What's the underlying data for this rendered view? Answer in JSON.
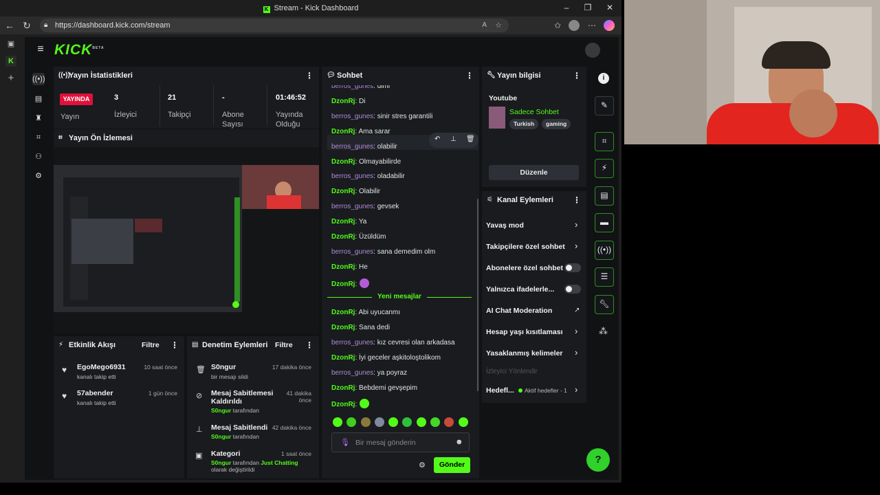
{
  "window": {
    "title": "Stream - Kick Dashboard",
    "url": "https://dashboard.kick.com/stream"
  },
  "brand": {
    "logo": "KICK",
    "beta": "BETA",
    "accent": "#53fc18"
  },
  "stats": {
    "title": "Yayın İstatistikleri",
    "live_badge": "YAYINDA",
    "stream_label": "Yayın",
    "viewers_value": "3",
    "viewers_label": "İzleyici",
    "followers_value": "21",
    "followers_label": "Takipçi",
    "subs_value": "-",
    "subs_label": "Abone Sayısı",
    "uptime_value": "01:46:52",
    "uptime_label": "Yayında Olduğu"
  },
  "preview": {
    "title": "Yayın Ön İzlemesi"
  },
  "chat": {
    "title": "Sohbet",
    "messages_before": [
      {
        "user": "berros_gunes",
        "text": ": dimi",
        "color": "purple"
      },
      {
        "user": "DzonRj",
        "text": ": Di",
        "color": "green"
      },
      {
        "user": "berros_gunes",
        "text": ": sinir stres garantili",
        "color": "purple"
      },
      {
        "user": "DzonRj",
        "text": ": Ama sarar",
        "color": "green"
      },
      {
        "user": "berros_gunes",
        "text": ": olabilir",
        "color": "purple"
      },
      {
        "user": "DzonRj",
        "text": ": Olmayabilirde",
        "color": "green"
      },
      {
        "user": "berros_gunes",
        "text": ": oladabilir",
        "color": "purple"
      },
      {
        "user": "DzonRj",
        "text": ": Olabilir",
        "color": "green"
      },
      {
        "user": "berros_gunes",
        "text": ": gevsek",
        "color": "purple"
      },
      {
        "user": "DzonRj",
        "text": ": Ya",
        "color": "green"
      },
      {
        "user": "DzonRj",
        "text": ": Üzüldüm",
        "color": "green"
      },
      {
        "user": "berros_gunes",
        "text": ": sana demedim olm",
        "color": "purple"
      },
      {
        "user": "DzonRj",
        "text": ": He",
        "color": "green"
      },
      {
        "user": "DzonRj",
        "text": ":",
        "color": "green"
      }
    ],
    "new_messages_divider": "Yeni mesajlar",
    "messages_after": [
      {
        "user": "DzonRj",
        "text": ": Abi uyucanmı",
        "color": "green"
      },
      {
        "user": "DzonRj",
        "text": ": Sana dedi",
        "color": "green"
      },
      {
        "user": "berros_gunes",
        "text": ": kız cevresi olan arkadasa",
        "color": "purple"
      },
      {
        "user": "DzonRj",
        "text": ": İyi geceler aşkitoloştolikom",
        "color": "green"
      },
      {
        "user": "berros_gunes",
        "text": ": ya poyraz",
        "color": "purple"
      },
      {
        "user": "DzonRj",
        "text": ": Bebdemi gevşepim",
        "color": "green"
      },
      {
        "user": "DzonRj",
        "text": ":",
        "color": "green"
      }
    ],
    "input_placeholder": "Bir mesaj gönderin",
    "send_label": "Gönder"
  },
  "stream_info": {
    "title": "Yayın bilgisi",
    "stream_title": "Youtube",
    "category": "Sadece Sohbet",
    "tags": [
      "Turkish",
      "gaming"
    ],
    "edit_label": "Düzenle"
  },
  "channel_actions": {
    "title": "Kanal Eylemleri",
    "items": [
      {
        "label": "Yavaş mod",
        "control": "chevron"
      },
      {
        "label": "Takipçilere özel sohbet",
        "control": "chevron"
      },
      {
        "label": "Abonelere özel sohbet",
        "control": "toggle"
      },
      {
        "label": "Yalnızca ifadelerle...",
        "control": "toggle"
      },
      {
        "label": "AI Chat Moderation",
        "control": "external"
      },
      {
        "label": "Hesap yaşı kısıtlaması",
        "control": "chevron"
      },
      {
        "label": "Yasaklanmış kelimeler",
        "control": "chevron"
      }
    ],
    "viewer_redirect": "İzleyici Yönlendir",
    "goals_label": "Hedefl...",
    "goals_status": "Aktif hedefler - 1"
  },
  "activity": {
    "title": "Etkinlik Akışı",
    "filter": "Filtre",
    "items": [
      {
        "name": "EgoMego6931",
        "sub": "kanalı takip etti",
        "time": "10 saat önce"
      },
      {
        "name": "57abender",
        "sub": "kanalı takip etti",
        "time": "1 gün önce"
      }
    ]
  },
  "moderation": {
    "title": "Denetim Eylemleri",
    "filter": "Filtre",
    "items": [
      {
        "name": "S0ngur",
        "sub": "bir mesajı sildi",
        "time": "17 dakika önce"
      },
      {
        "name": "Mesaj Sabitlemesi Kaldırıldı",
        "by": "S0ngur",
        "sub": " tarafından",
        "time": "41 dakika önce"
      },
      {
        "name": "Mesaj Sabitlendi",
        "by": "S0ngur",
        "sub": " tarafından",
        "time": "42 dakika önce"
      },
      {
        "name": "Kategori",
        "by": "S0ngur",
        "sub": " tarafından ",
        "category": "Just Chatting",
        "sub2": "olarak değiştirildi",
        "time": "1 saat önce"
      }
    ]
  }
}
